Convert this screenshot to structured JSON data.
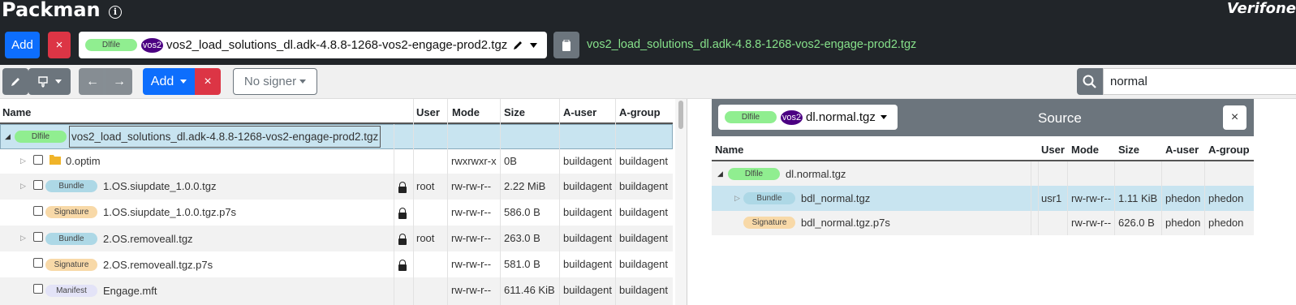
{
  "app": {
    "title": "Packman",
    "brand": "Verifone"
  },
  "header": {
    "add_label": "Add",
    "close_label": "×",
    "file_badge": "Dlfile",
    "vos_badge": "vos2",
    "file_name": "vos2_load_solutions_dl.adk-4.8.8-1268-vos2-engage-prod2.tgz",
    "green_text": "vos2_load_solutions_dl.adk-4.8.8-1268-vos2-engage-prod2.tgz"
  },
  "toolbar": {
    "back": "←",
    "fwd": "→",
    "add_label": "Add",
    "close_label": "×",
    "signer_label": "No signer",
    "search_value": "normal"
  },
  "left_table": {
    "headers": [
      "Name",
      "User",
      "Mode",
      "Size",
      "A-user",
      "A-group"
    ],
    "rows": [
      {
        "badge": "Dlfile",
        "name": "vos2_load_solutions_dl.adk-4.8.8-1268-vos2-engage-prod2.tgz",
        "user": "",
        "mode": "",
        "size": "",
        "auser": "",
        "agroup": ""
      },
      {
        "badge": "",
        "name": "0.optim",
        "user": "",
        "mode": "rwxrwxr-x",
        "size": "0B",
        "auser": "buildagent",
        "agroup": "buildagent"
      },
      {
        "badge": "Bundle",
        "name": "1.OS.siupdate_1.0.0.tgz",
        "user": "root",
        "mode": "rw-rw-r--",
        "size": "2.22 MiB",
        "auser": "buildagent",
        "agroup": "buildagent"
      },
      {
        "badge": "Signature",
        "name": "1.OS.siupdate_1.0.0.tgz.p7s",
        "user": "",
        "mode": "rw-rw-r--",
        "size": "586.0 B",
        "auser": "buildagent",
        "agroup": "buildagent"
      },
      {
        "badge": "Bundle",
        "name": "2.OS.removeall.tgz",
        "user": "root",
        "mode": "rw-rw-r--",
        "size": "263.0 B",
        "auser": "buildagent",
        "agroup": "buildagent"
      },
      {
        "badge": "Signature",
        "name": "2.OS.removeall.tgz.p7s",
        "user": "",
        "mode": "rw-rw-r--",
        "size": "581.0 B",
        "auser": "buildagent",
        "agroup": "buildagent"
      },
      {
        "badge": "Manifest",
        "name": "Engage.mft",
        "user": "",
        "mode": "rw-rw-r--",
        "size": "611.46 KiB",
        "auser": "buildagent",
        "agroup": "buildagent"
      }
    ]
  },
  "right_panel": {
    "file_badge": "Dlfile",
    "vos_badge": "vos2",
    "file_name": "dl.normal.tgz",
    "title": "Source",
    "close_label": "×",
    "headers": [
      "Name",
      "User",
      "Mode",
      "Size",
      "A-user",
      "A-group"
    ],
    "rows": [
      {
        "badge": "Dlfile",
        "name": "dl.normal.tgz",
        "user": "",
        "mode": "",
        "size": "",
        "auser": "",
        "agroup": ""
      },
      {
        "badge": "Bundle",
        "name": "bdl_normal.tgz",
        "user": "usr1",
        "mode": "rw-rw-r--",
        "size": "1.11 KiB",
        "auser": "phedon",
        "agroup": "phedon"
      },
      {
        "badge": "Signature",
        "name": "bdl_normal.tgz.p7s",
        "user": "",
        "mode": "rw-rw-r--",
        "size": "626.0 B",
        "auser": "phedon",
        "agroup": "phedon"
      }
    ]
  },
  "colors": {
    "dark": "#212529",
    "blue": "#0d6efd",
    "red": "#dc3545",
    "gray": "#6c757d",
    "selected": "#c8e4f0"
  }
}
